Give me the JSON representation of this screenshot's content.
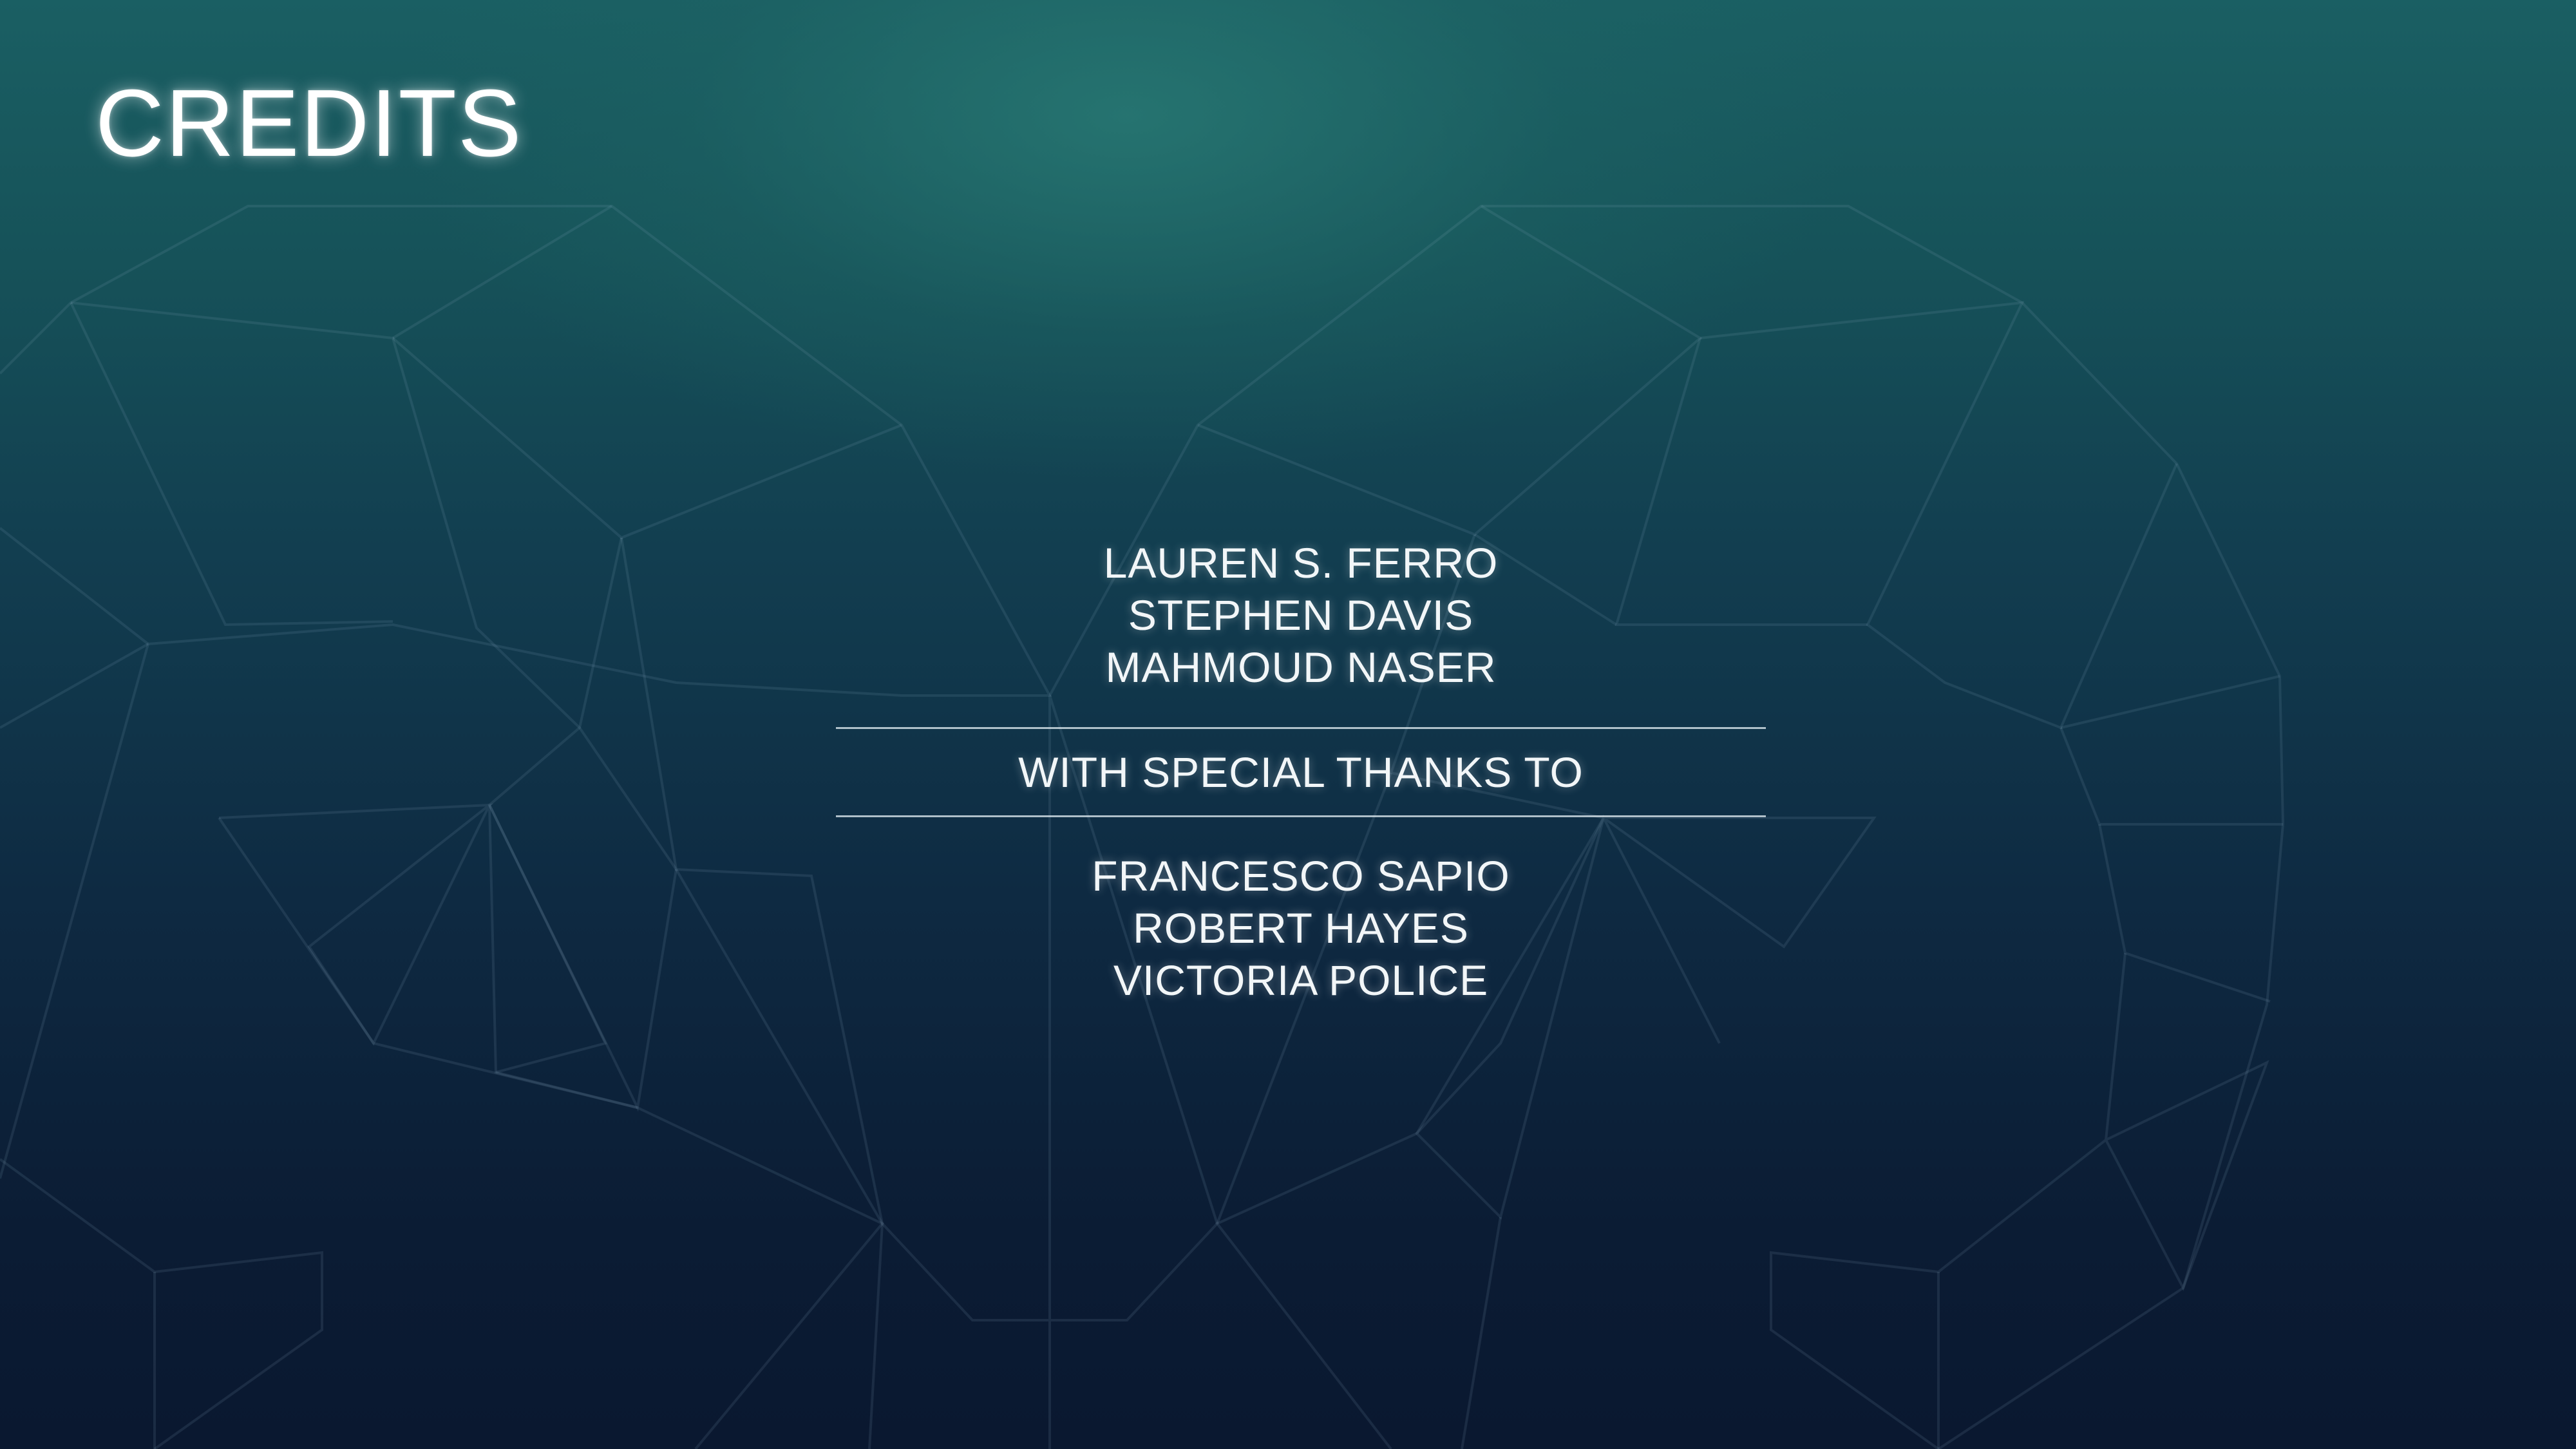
{
  "slide": {
    "title": "CREDITS",
    "authors": [
      "LAUREN S. FERRO",
      "STEPHEN DAVIS",
      "MAHMOUD NASER"
    ],
    "thanks_heading": "WITH SPECIAL THANKS TO",
    "thanks": [
      "FRANCESCO SAPIO",
      "ROBERT HAYES",
      "VICTORIA POLICE"
    ]
  },
  "colors": {
    "background_top": "#1a5f63",
    "background_bottom": "#0a1830",
    "text": "#ffffff"
  }
}
